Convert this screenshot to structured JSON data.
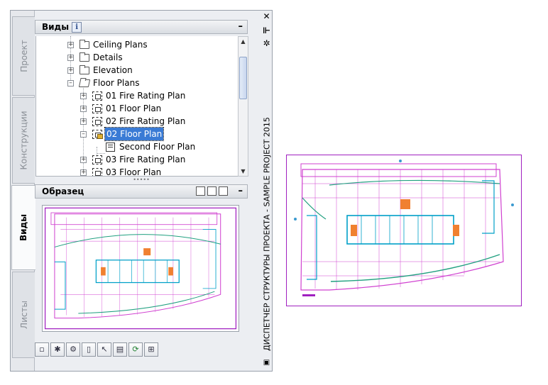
{
  "palette": {
    "title": "ДИСПЕТЧЕР СТРУКТУРЫ ПРОЕКТА - SAMPLE PROJECT 2015",
    "close_icon": "✕",
    "tabs": [
      "Проект",
      "Конструкции",
      "Виды",
      "Листы"
    ],
    "active_tab": "Виды"
  },
  "views_panel": {
    "title": "Виды",
    "info_label": "i",
    "collapse_label": "–",
    "tree": [
      {
        "label": "Ceiling Plans",
        "type": "folder"
      },
      {
        "label": "Details",
        "type": "folder"
      },
      {
        "label": "Elevation",
        "type": "folder"
      },
      {
        "label": "Floor Plans",
        "type": "folder-open"
      },
      {
        "label": "01 Fire Rating Plan",
        "type": "view"
      },
      {
        "label": "01 Floor Plan",
        "type": "view"
      },
      {
        "label": "02 Fire Rating Plan",
        "type": "view"
      },
      {
        "label": "02 Floor Plan",
        "type": "view",
        "selected": true
      },
      {
        "label": "Second Floor Plan",
        "type": "sheet-view"
      },
      {
        "label": "03 Fire Rating Plan",
        "type": "view"
      },
      {
        "label": "03 Floor Plan",
        "type": "view"
      }
    ]
  },
  "preview_panel": {
    "title": "Образец",
    "collapse_label": "–"
  },
  "colors": {
    "selection": "#3a7bd5",
    "drawing_frame": "#a020c0",
    "drawing_walls": "#d040d0",
    "drawing_cyan": "#00a0c8",
    "drawing_green": "#20a080"
  }
}
